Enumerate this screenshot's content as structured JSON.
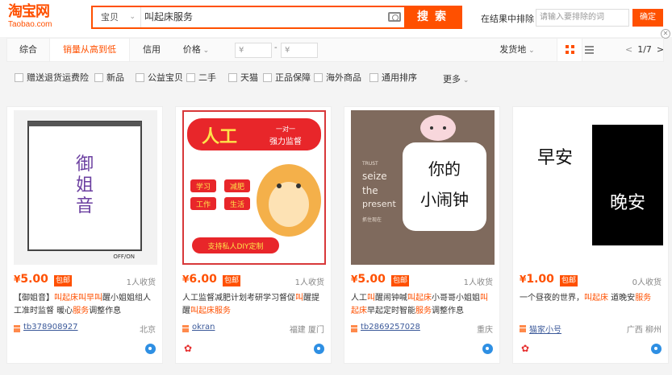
{
  "header": {
    "logo_cn": "淘宝网",
    "logo_en": "Taobao.com",
    "search_scope": "宝贝",
    "search_query": "叫起床服务",
    "search_button": "搜索",
    "within_label": "在结果中排除",
    "within_placeholder": "请输入要排除的词",
    "within_button": "确定"
  },
  "sortbar": {
    "items": [
      "综合",
      "销量从高到低",
      "信用",
      "价格"
    ],
    "price_from": "¥",
    "price_to": "¥",
    "dash": "-",
    "ship_from": "发货地",
    "page": "1/7",
    "prev": "<",
    "next": ">"
  },
  "filters": {
    "items": [
      "赠送退货运费险",
      "新品",
      "公益宝贝",
      "二手",
      "天猫",
      "正品保障",
      "海外商品",
      "通用排序"
    ],
    "more": "更多"
  },
  "products": [
    {
      "price_symbol": "¥",
      "price": "5.00",
      "badge": "包邮",
      "sales": "1人收货",
      "title_parts": [
        "【御姐音】",
        "叫起床",
        "叫早",
        "叫",
        "醒小姐姐组人工准时监督 暖心",
        "服务",
        "调整作息"
      ],
      "shop": "tb378908927",
      "location": "北京",
      "image_text": "御姐音",
      "image_caption": "OFF/ON"
    },
    {
      "price_symbol": "¥",
      "price": "6.00",
      "badge": "包邮",
      "sales": "1人收货",
      "title_parts": [
        "人工监督减肥计划考研学习督促",
        "叫",
        "醒提醒",
        "叫起床服务"
      ],
      "shop": "okran",
      "location": "福建 厦门",
      "image_banner": "人工",
      "image_banner_sub1": "一对一",
      "image_banner_sub2": "强力监督",
      "image_tags": [
        "学习",
        "减肥",
        "工作",
        "生活"
      ],
      "image_footer": "支持私人DIY定制"
    },
    {
      "price_symbol": "¥",
      "price": "5.00",
      "badge": "包邮",
      "sales": "1人收货",
      "title_parts": [
        "人工",
        "叫",
        "醒闹钟喊",
        "叫起床",
        "小哥哥小姐姐",
        "叫起床",
        "早起定时智能",
        "服务",
        "调整作息"
      ],
      "shop": "tb2869257028",
      "location": "重庆",
      "image_main1": "你的",
      "image_main2": "小闹钟",
      "image_side1": "seize",
      "image_side2": "the",
      "image_side3": "present",
      "image_side_small": "抓住现在",
      "image_side_top": "TRUST"
    },
    {
      "price_symbol": "¥",
      "price": "1.00",
      "badge": "包邮",
      "sales": "0人收货",
      "title_parts": [
        "一个昼夜的世界，",
        "叫起床",
        "  道晚安",
        "服务"
      ],
      "shop": "猫家小号",
      "location": "广西 柳州",
      "image_left": "早安",
      "image_right": "晚安"
    }
  ],
  "colors": {
    "brand": "#ff5000",
    "link": "#3c5a9a"
  }
}
